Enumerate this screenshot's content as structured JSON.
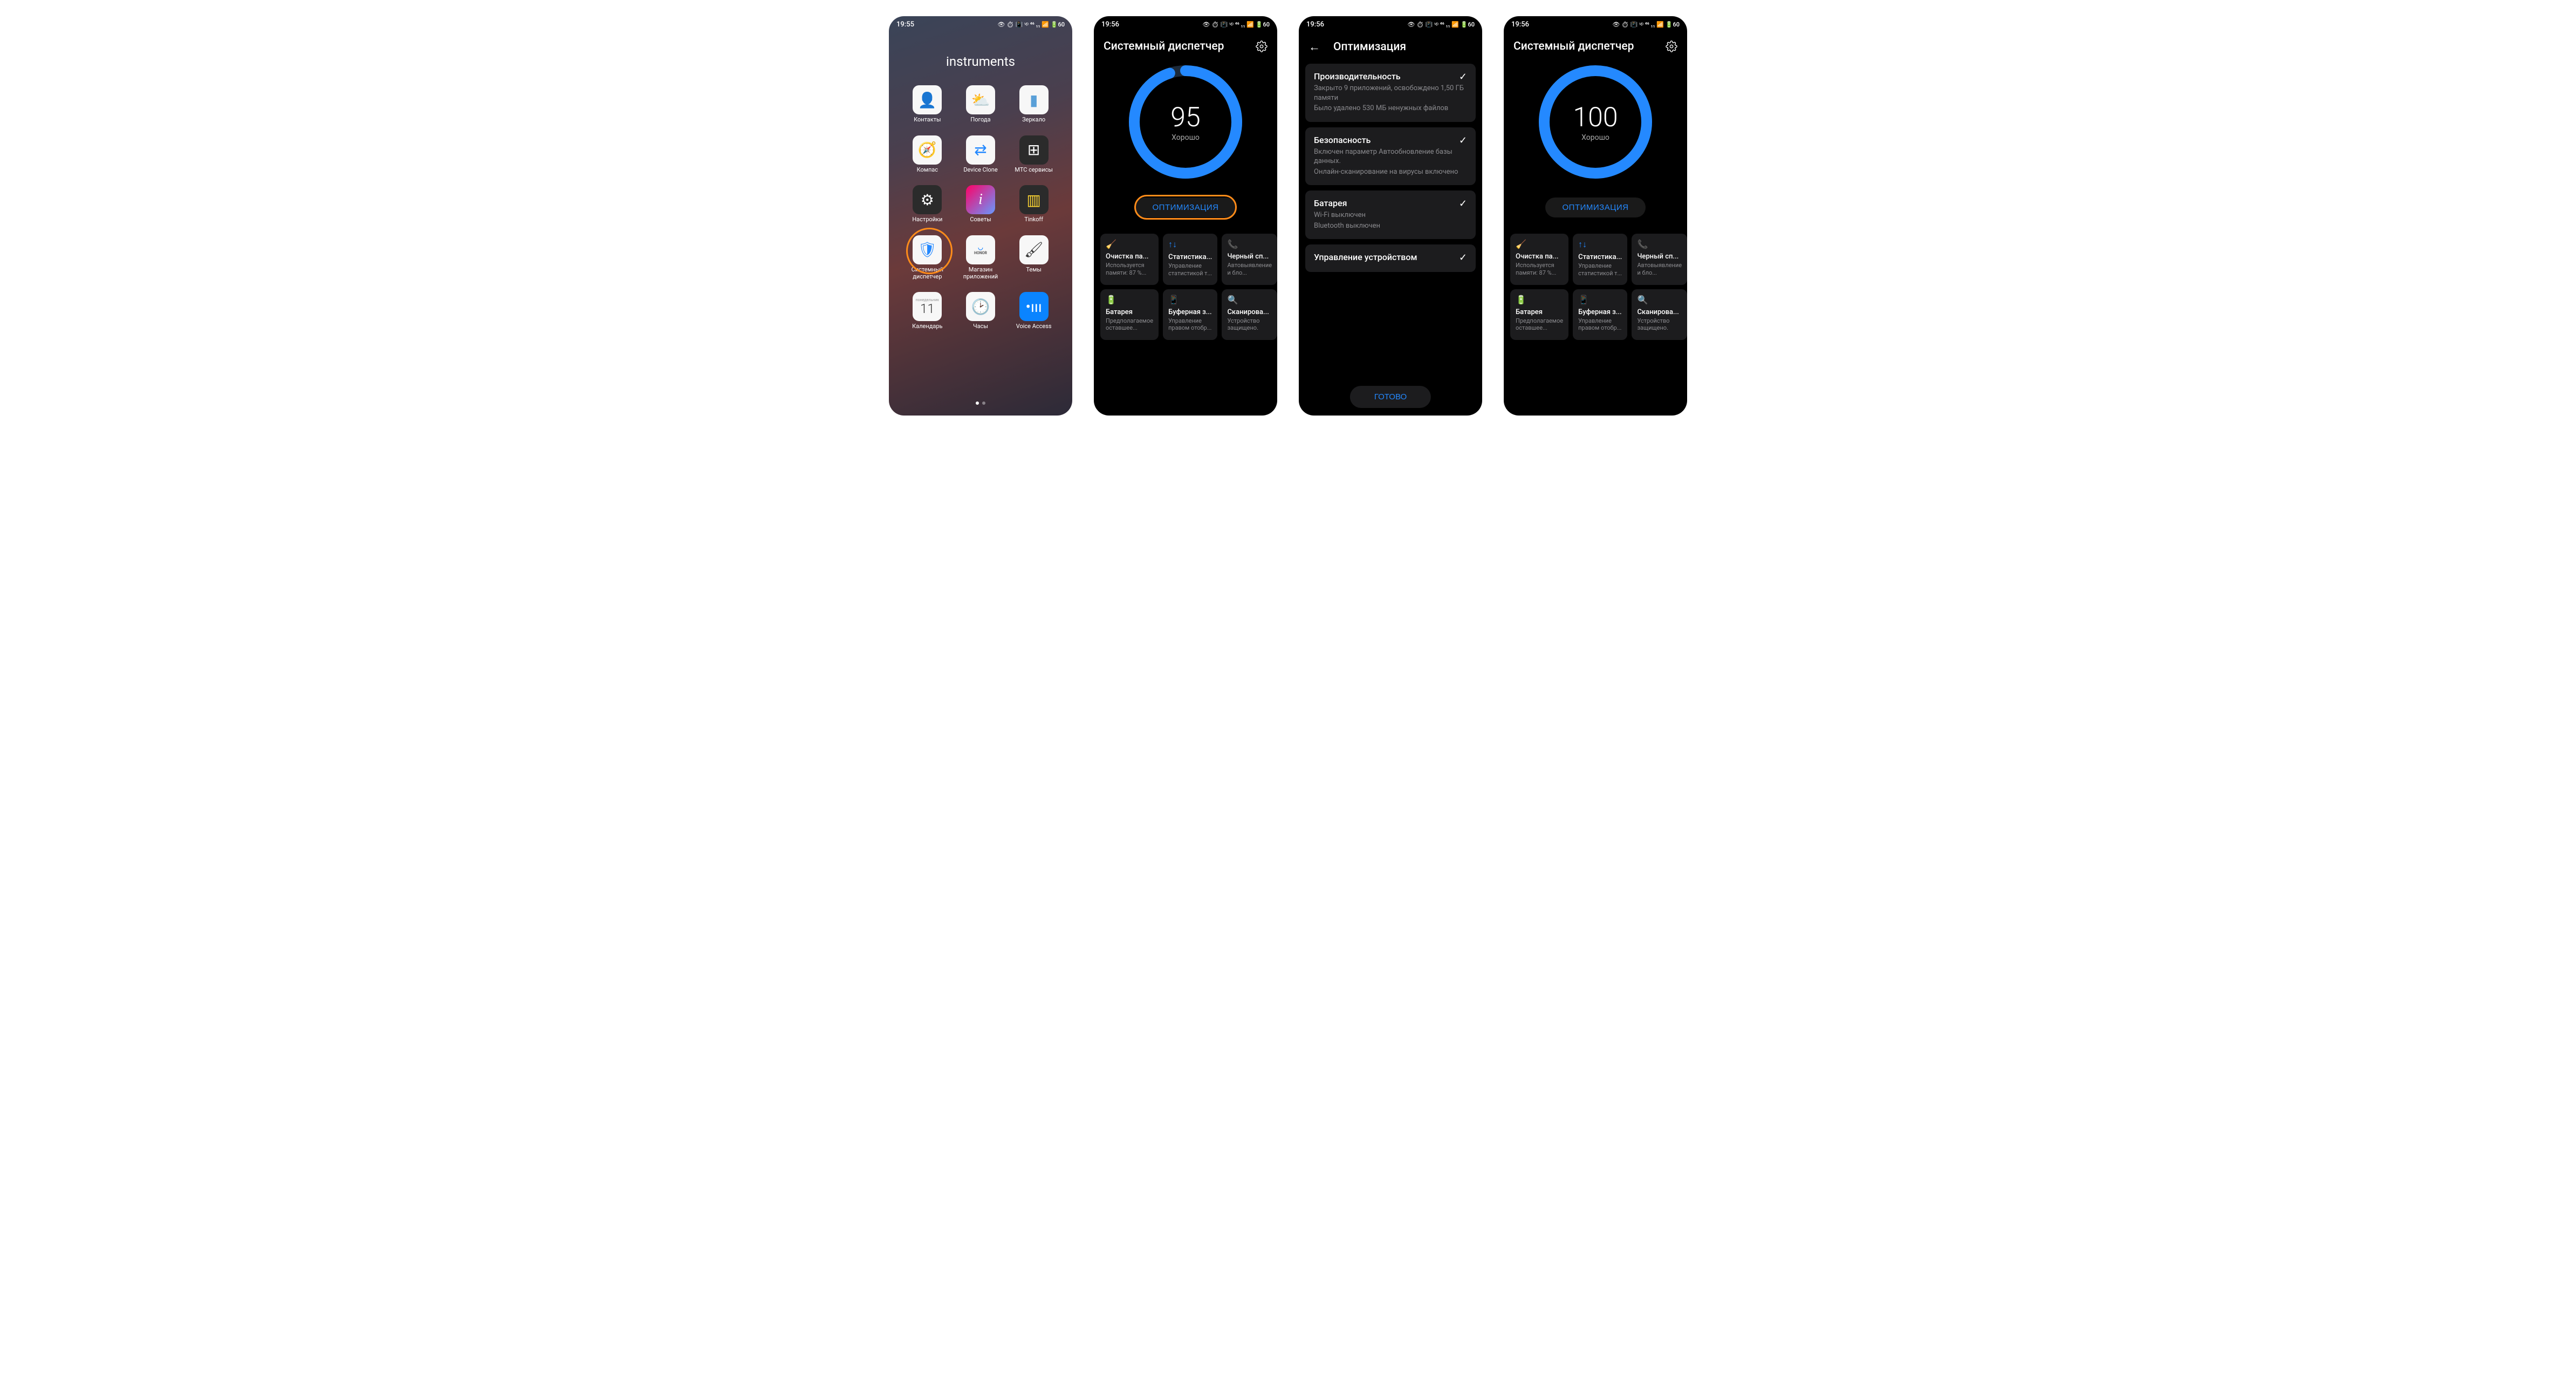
{
  "status_time": "19:55",
  "status_time_alt": "19:56",
  "status_icons_text": "👁 ⏱ 📳 ᵛᵖ ⁴⁶ ₁₁ 📶 🔋60",
  "home": {
    "folder_title": "instruments",
    "apps": [
      {
        "label": "Контакты"
      },
      {
        "label": "Погода"
      },
      {
        "label": "Зеркало"
      },
      {
        "label": "Компас"
      },
      {
        "label": "Device Clone"
      },
      {
        "label": "МТС сервисы"
      },
      {
        "label": "Настройки"
      },
      {
        "label": "Советы"
      },
      {
        "label": "Tinkoff"
      },
      {
        "label": "Системный диспетчер"
      },
      {
        "label": "Магазин приложений"
      },
      {
        "label": "Темы"
      },
      {
        "label": "Календарь"
      },
      {
        "label": "Часы"
      },
      {
        "label": "Voice Access"
      }
    ],
    "calendar_day_label": "понедельник",
    "calendar_day_num": "11"
  },
  "manager": {
    "title": "Системный диспетчер",
    "score_95": "95",
    "score_100": "100",
    "rating": "Хорошо",
    "optimize_btn": "ОПТИМИЗАЦИЯ",
    "tiles": [
      {
        "title": "Очистка па...",
        "sub": "Используется памяти: 87 %..."
      },
      {
        "title": "Статистика...",
        "sub": "Управление статистикой т..."
      },
      {
        "title": "Черный сп...",
        "sub": "Автовыявление и бло..."
      },
      {
        "title": "Батарея",
        "sub": "Предполагаемое оставшее..."
      },
      {
        "title": "Буферная з...",
        "sub": "Управление правом отобр..."
      },
      {
        "title": "Сканирова...",
        "sub": "Устройство защищено."
      }
    ]
  },
  "optimize": {
    "title": "Оптимизация",
    "sections": [
      {
        "title": "Производительность",
        "details": [
          "Закрыто 9 приложений, освобождено 1,50 ГБ памяти",
          "Было удалено 530 МБ ненужных файлов"
        ]
      },
      {
        "title": "Безопасность",
        "details": [
          "Включен параметр Автообновление базы данных.",
          "Онлайн-сканирование на вирусы включено"
        ]
      },
      {
        "title": "Батарея",
        "details": [
          "Wi-Fi выключен",
          "Bluetooth выключен"
        ]
      },
      {
        "title": "Управление устройством",
        "details": []
      }
    ],
    "done_btn": "ГОТОВО"
  }
}
